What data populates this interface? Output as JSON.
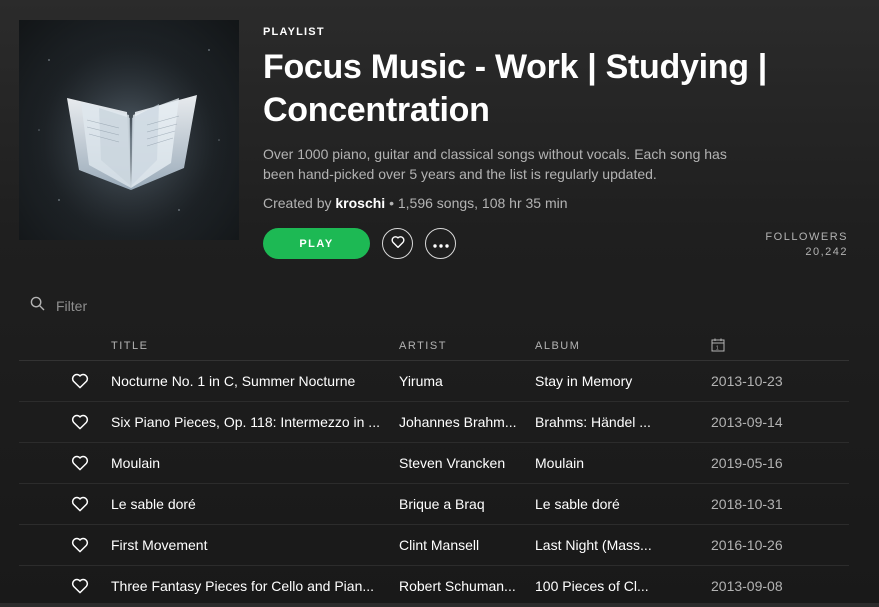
{
  "playlist": {
    "type_label": "PLAYLIST",
    "title": "Focus Music - Work | Studying | Concentration",
    "description": "Over 1000 piano, guitar and classical songs without vocals. Each song has been hand-picked over 5 years and the list is regularly updated.",
    "created_by_label": "Created by",
    "owner": "kroschi",
    "stats": " • 1,596 songs, 108 hr 35 min"
  },
  "actions": {
    "play_label": "PLAY",
    "like_icon": "heart-icon",
    "more_icon": "ellipsis-icon"
  },
  "followers": {
    "label": "FOLLOWERS",
    "count": "20,242"
  },
  "filter": {
    "placeholder": "Filter",
    "value": ""
  },
  "table": {
    "headers": {
      "title": "TITLE",
      "artist": "ARTIST",
      "album": "ALBUM",
      "date_icon": "calendar-icon"
    },
    "rows": [
      {
        "title": "Nocturne No. 1 in C, Summer Nocturne",
        "artist": "Yiruma",
        "album": "Stay in Memory",
        "date": "2013-10-23"
      },
      {
        "title": "Six Piano Pieces, Op. 118: Intermezzo in ...",
        "artist": "Johannes Brahm...",
        "album": "Brahms: Händel ...",
        "date": "2013-09-14"
      },
      {
        "title": "Moulain",
        "artist": "Steven Vrancken",
        "album": "Moulain",
        "date": "2019-05-16"
      },
      {
        "title": "Le sable doré",
        "artist": "Brique a Braq",
        "album": "Le sable doré",
        "date": "2018-10-31"
      },
      {
        "title": "First Movement",
        "artist": "Clint Mansell",
        "album": "Last Night (Mass...",
        "date": "2016-10-26"
      },
      {
        "title": "Three Fantasy Pieces for Cello and Pian...",
        "artist": "Robert Schuman...",
        "album": "100 Pieces of Cl...",
        "date": "2013-09-08"
      }
    ]
  },
  "colors": {
    "accent": "#1db954",
    "background": "#191919",
    "text_secondary": "#b3b3b3"
  }
}
